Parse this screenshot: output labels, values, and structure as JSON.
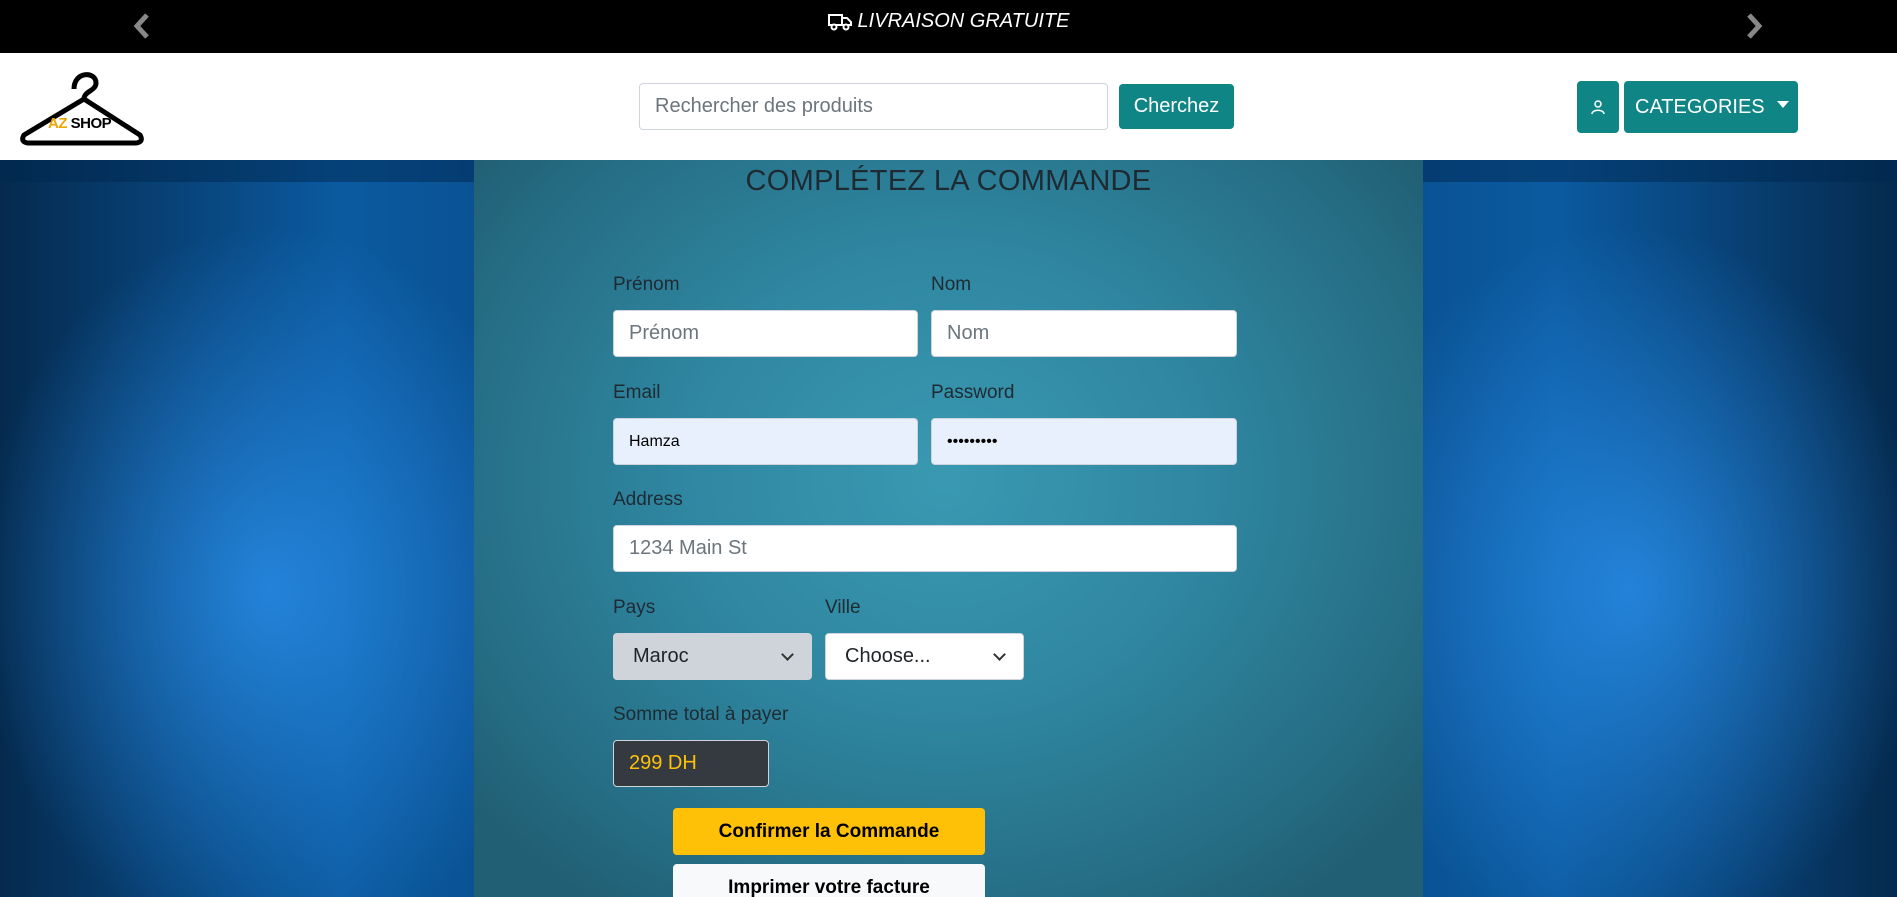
{
  "topbar": {
    "message": "LIVRAISON GRATUITE",
    "icons": {
      "prev": "chevron-left-icon",
      "next": "chevron-right-icon",
      "truck": "truck-icon"
    }
  },
  "header": {
    "logo": {
      "az": "AZ",
      "shop": "SHOP"
    },
    "search": {
      "placeholder": "Rechercher des produits",
      "value": "",
      "button": "Cherchez"
    },
    "user_icon": "user-icon",
    "categories_label": "CATEGORIES"
  },
  "form": {
    "title": "COMPLÉTEZ LA COMMANDE",
    "prenom": {
      "label": "Prénom",
      "placeholder": "Prénom"
    },
    "nom": {
      "label": "Nom",
      "placeholder": "Nom"
    },
    "email": {
      "label": "Email",
      "value": "Hamza"
    },
    "password": {
      "label": "Password",
      "value": "•••••••••"
    },
    "address": {
      "label": "Address",
      "placeholder": "1234 Main St"
    },
    "pays": {
      "label": "Pays",
      "selected": "Maroc"
    },
    "ville": {
      "label": "Ville",
      "selected": "Choose..."
    },
    "total": {
      "label": "Somme total à payer",
      "value": "299 DH"
    },
    "confirm_button": "Confirmer la Commande",
    "print_button": "Imprimer votre facture"
  },
  "colors": {
    "accent": "#0f8585",
    "warning": "#ffc107",
    "dark": "#343a40"
  }
}
